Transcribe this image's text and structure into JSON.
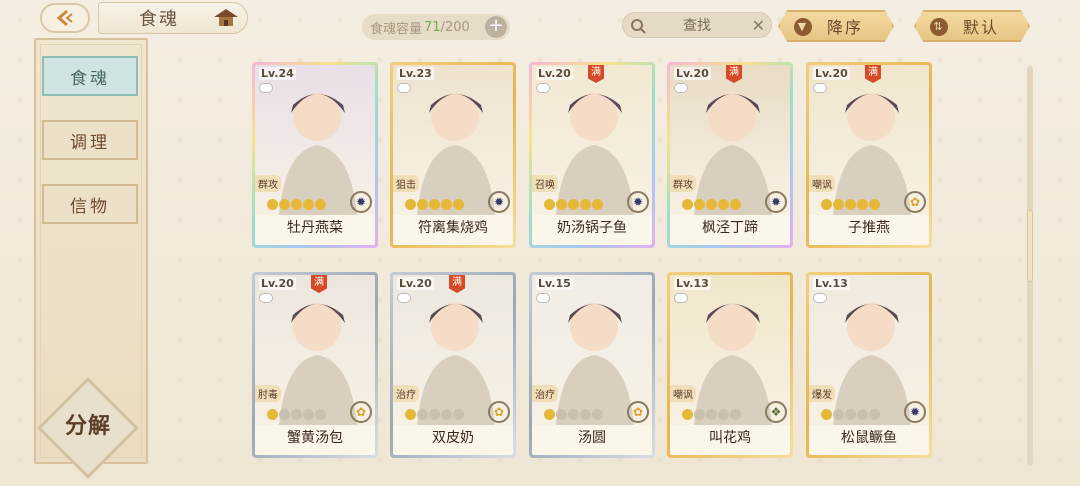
{
  "header": {
    "title": "食魂",
    "capacity_label": "食魂容量",
    "capacity_current": "71",
    "capacity_max": "/200",
    "search_placeholder": "查找",
    "sort_order_label": "降序",
    "sort_mode_label": "默认"
  },
  "sidebar": {
    "tabs": [
      {
        "label": "食魂",
        "active": true
      },
      {
        "label": "调理",
        "active": false
      },
      {
        "label": "信物",
        "active": false
      }
    ],
    "decompose_label": "分解"
  },
  "cards": [
    {
      "level": "Lv.24",
      "name": "牡丹燕菜",
      "role": "群攻",
      "full": false,
      "frame": "rainbow",
      "stars": 5,
      "element": "dark"
    },
    {
      "level": "Lv.23",
      "name": "符离集烧鸡",
      "role": "狙击",
      "full": false,
      "frame": "gold",
      "stars": 5,
      "element": "dark"
    },
    {
      "level": "Lv.20",
      "name": "奶汤锅子鱼",
      "role": "召唤",
      "full": true,
      "frame": "rainbow",
      "stars": 5,
      "element": "dark"
    },
    {
      "level": "Lv.20",
      "name": "枫泾丁蹄",
      "role": "群攻",
      "full": true,
      "frame": "rainbow",
      "stars": 5,
      "element": "dark"
    },
    {
      "level": "Lv.20",
      "name": "子推燕",
      "role": "嘲讽",
      "full": true,
      "frame": "gold",
      "stars": 5,
      "element": "light"
    },
    {
      "level": "Lv.20",
      "name": "蟹黄汤包",
      "role": "肘毒",
      "full": true,
      "frame": "silver",
      "stars": 1,
      "element": "light"
    },
    {
      "level": "Lv.20",
      "name": "双皮奶",
      "role": "治疗",
      "full": true,
      "frame": "silver",
      "stars": 1,
      "element": "light"
    },
    {
      "level": "Lv.15",
      "name": "汤圆",
      "role": "治疗",
      "full": false,
      "frame": "silver",
      "stars": 1,
      "element": "light"
    },
    {
      "level": "Lv.13",
      "name": "叫花鸡",
      "role": "嘲讽",
      "full": false,
      "frame": "gold",
      "stars": 1,
      "element": "wind"
    },
    {
      "level": "Lv.13",
      "name": "松鼠鳜鱼",
      "role": "爆发",
      "full": false,
      "frame": "gold",
      "stars": 1,
      "element": "dark"
    }
  ]
}
